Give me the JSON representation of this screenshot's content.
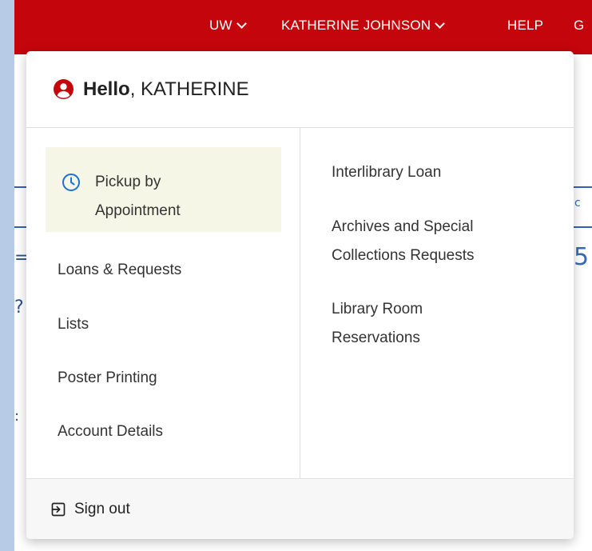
{
  "topnav": {
    "campus_label": "UW",
    "user_label": "KATHERINE JOHNSON",
    "help_label": "HELP",
    "cut_label": "G"
  },
  "dropdown": {
    "greeting_bold": "Hello",
    "greeting_name": ", KATHERINE",
    "left_items": [
      {
        "label": "Pickup by Appointment",
        "icon": "clock-icon",
        "highlighted": true
      },
      {
        "label": "Loans & Requests"
      },
      {
        "label": "Lists"
      },
      {
        "label": "Poster Printing"
      },
      {
        "label": "Account Details"
      }
    ],
    "right_items": [
      {
        "label": "Interlibrary Loan"
      },
      {
        "label": "Archives and Special Collections Requests"
      },
      {
        "label": "Library Room Reservations"
      }
    ],
    "signout_label": "Sign out"
  },
  "colors": {
    "brand_red": "#c5050c",
    "highlight_bg": "#f6f6e7",
    "icon_blue": "#1f6fd6",
    "outer_bg": "#b7cbe6"
  }
}
